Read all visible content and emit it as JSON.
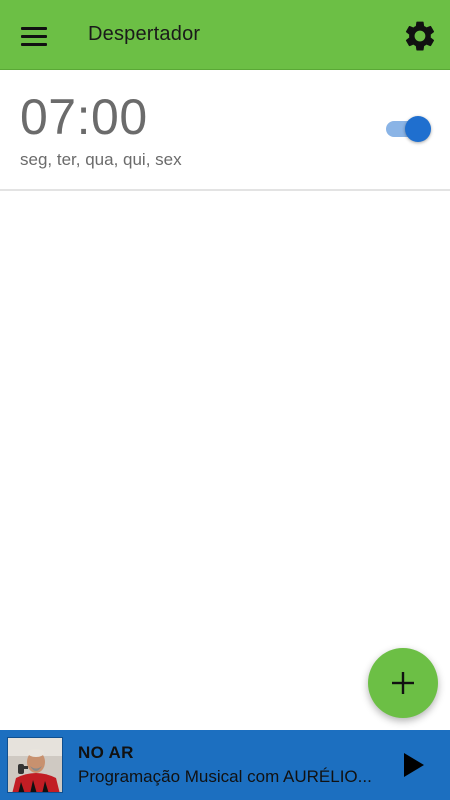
{
  "appbar": {
    "title": "Despertador",
    "menu_icon": "hamburger-menu-icon",
    "settings_icon": "gear-icon"
  },
  "alarm": {
    "time": "07:00",
    "days": "seg, ter, qua, qui, sex",
    "enabled": true
  },
  "fab": {
    "icon": "plus-icon"
  },
  "player": {
    "status": "NO AR",
    "program": "Programação Musical com AURÉLIO...",
    "play_icon": "play-icon"
  },
  "colors": {
    "appbar": "#6cbf45",
    "fab": "#6cbf45",
    "player": "#1c6fc0",
    "toggle_on": "#1f6fcf",
    "toggle_track": "#8ab4e6",
    "text_muted": "#6b6b6b"
  }
}
